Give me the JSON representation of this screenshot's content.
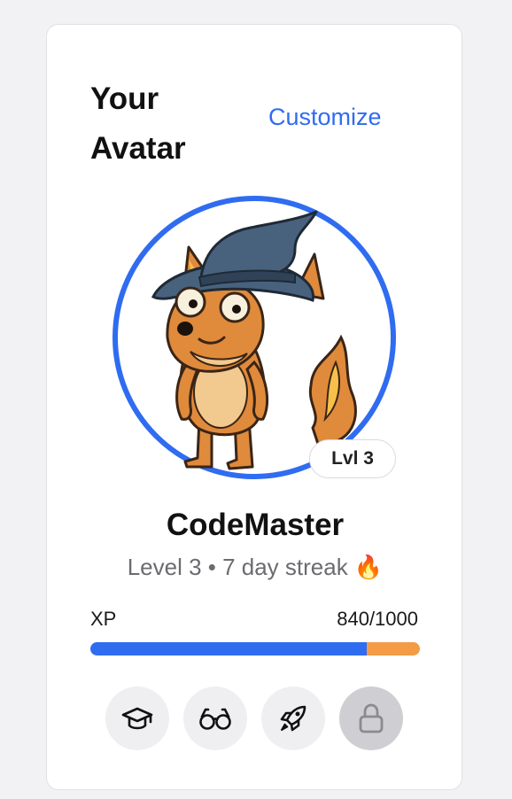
{
  "card": {
    "title": "Your Avatar",
    "customize_label": "Customize"
  },
  "avatar": {
    "character": "fox wearing a wizard hat",
    "ring_color": "#2f6cf0",
    "level_badge": "Lvl 3"
  },
  "profile": {
    "username": "CodeMaster",
    "subline": "Level 3 • 7 day streak 🔥"
  },
  "xp": {
    "label": "XP",
    "value_text": "840/1000",
    "current": 840,
    "max": 1000,
    "fill_color": "#2f6cf0",
    "rest_color": "#f39b45"
  },
  "badges": [
    {
      "icon": "graduation-cap-icon",
      "locked": false
    },
    {
      "icon": "glasses-icon",
      "locked": false
    },
    {
      "icon": "rocket-icon",
      "locked": false
    },
    {
      "icon": "lock-icon",
      "locked": true
    }
  ]
}
